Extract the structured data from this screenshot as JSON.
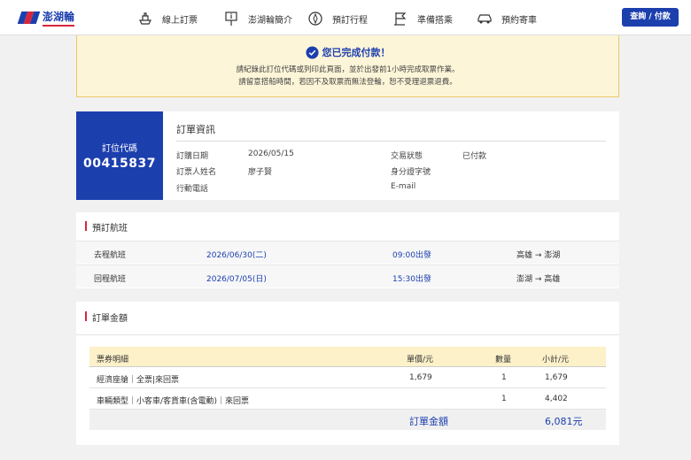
{
  "header": {
    "brand": "澎湖輪",
    "nav": [
      {
        "label": "線上訂票",
        "icon": "ship-icon"
      },
      {
        "label": "澎湖輪簡介",
        "icon": "info-sign-icon"
      },
      {
        "label": "預訂行程",
        "icon": "compass-icon"
      },
      {
        "label": "準備搭乘",
        "icon": "flag-icon"
      },
      {
        "label": "預約寄車",
        "icon": "car-icon"
      }
    ],
    "login_label": "查詢 / 付款"
  },
  "notice": {
    "title": "您已完成付款！",
    "line1": "請紀錄此訂位代碼或列印此頁面，並於出發前1小時完成取票作業。",
    "line2": "請留意搭船時間，若因不及取票而無法登輪，恕不受理退票退費。"
  },
  "order": {
    "pnr_label": "訂位代碼",
    "pnr_code": "00415837",
    "title": "訂單資訊",
    "purchase_date_label": "訂購日期",
    "purchase_date": "2026/05/15",
    "status_label": "交易狀態",
    "status": "已付款",
    "name_label": "訂票人姓名",
    "name": "廖子賢",
    "id_label": "身分證字號",
    "id_value": "",
    "phone_label": "行動電話",
    "phone": "",
    "email_label": "E-mail",
    "email": ""
  },
  "flights": {
    "title": "預訂航班",
    "rows": [
      {
        "type": "去程航班",
        "date": "2026/06/30(二)",
        "time": "09:00出發",
        "route": "高雄 → 澎湖"
      },
      {
        "type": "回程航班",
        "date": "2026/07/05(日)",
        "time": "15:30出發",
        "route": "澎湖 → 高雄"
      }
    ]
  },
  "amount": {
    "title": "訂單金額",
    "headers": {
      "item": "票券明細",
      "price": "單價/元",
      "qty": "數量",
      "subtotal": "小計/元"
    },
    "rows": [
      {
        "item": "經濟座艙｜全票|來回票",
        "price": "1,679",
        "qty": "1",
        "subtotal": "1,679"
      },
      {
        "item": "車輛類型｜小客車/客貨車(含電動)｜來回票",
        "price": "",
        "qty": "1",
        "subtotal": "4,402"
      }
    ],
    "total_label": "訂單金額",
    "total": "6,081元"
  }
}
